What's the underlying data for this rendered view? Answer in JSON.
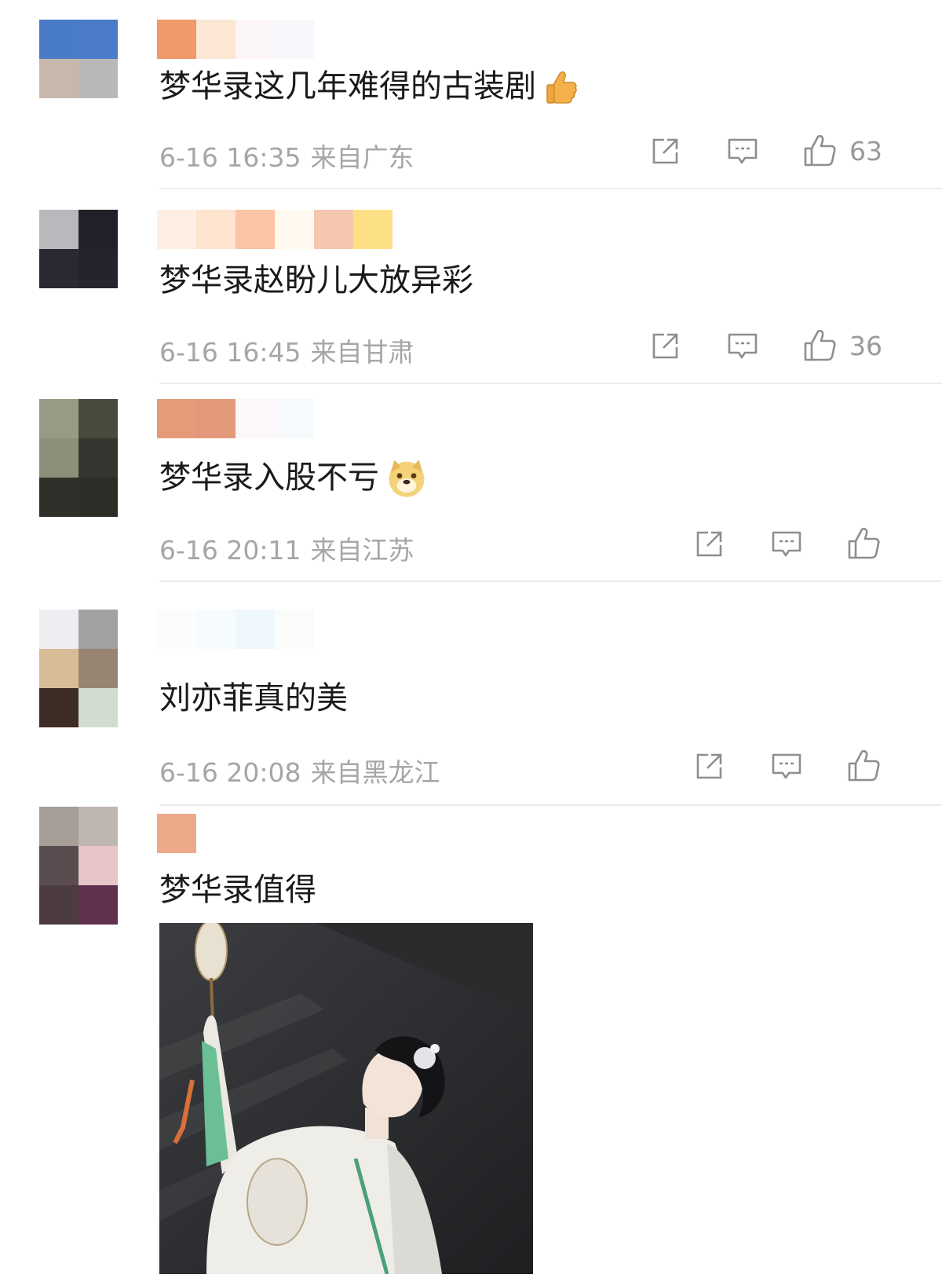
{
  "comments": [
    {
      "text": "梦华录这几年难得的古装剧",
      "time": "6-16 16:35",
      "location": "来自广东",
      "likes": "63",
      "emoji": "thumbs-up",
      "avatar_colors": [
        "#4a7bc6",
        "#4c7cc8",
        "#c8b8ac",
        "#b8b8b6"
      ],
      "name_colors": [
        "#f0996a",
        "#fbe7d4",
        "#fdf6f6",
        "#f8f8fc"
      ]
    },
    {
      "text": "梦华录赵盼儿大放异彩",
      "time": "6-16 16:45",
      "location": "来自甘肃",
      "likes": "36",
      "emoji": "",
      "avatar_colors": [
        "#b9b9bd",
        "#222028",
        "#2a2830",
        "#26222e"
      ],
      "name_colors": [
        "#fdefe3",
        "#fde4cf",
        "#fbc4a4",
        "#fff9ef",
        "#f5c7ae",
        "#fddf86"
      ]
    },
    {
      "text": "梦华录入股不亏",
      "time": "6-16 20:11",
      "location": "来自江苏",
      "likes": "",
      "emoji": "doge",
      "avatar_colors": [
        "#959b85",
        "#494a3e",
        "#8c907a",
        "#363630",
        "#30302a",
        "#2e2c26"
      ],
      "name_colors": [
        "#e69a7a",
        "#e3987c",
        "#fdf8f8",
        "#f6fafc"
      ]
    },
    {
      "text": "刘亦菲真的美",
      "time": "6-16 20:08",
      "location": "来自黑龙江",
      "likes": "",
      "emoji": "",
      "avatar_colors": [
        "#eeeef2",
        "#a2a19f",
        "#d8bc98",
        "#978572",
        "#3e2c26",
        "#d2ddd0"
      ],
      "name_colors": [
        "#fafcfe",
        "#f6fbfe",
        "#eef8fc",
        "#fafcfa"
      ]
    },
    {
      "text": "梦华录值得",
      "time": "",
      "location": "",
      "likes": "",
      "emoji": "",
      "avatar_colors": [
        "#a79e98",
        "#c0b6b0",
        "#594d50",
        "#e6c6c6",
        "#4c3c40",
        "#60304e"
      ],
      "name_colors": [
        "#ecaa8a"
      ]
    }
  ],
  "icons": {
    "share": "share-icon",
    "reply": "comment-icon",
    "like": "thumbs-up-icon"
  },
  "colors": {
    "meta_text": "#a6a6a6",
    "divider": "#ececec",
    "text": "#1a1a1a"
  }
}
